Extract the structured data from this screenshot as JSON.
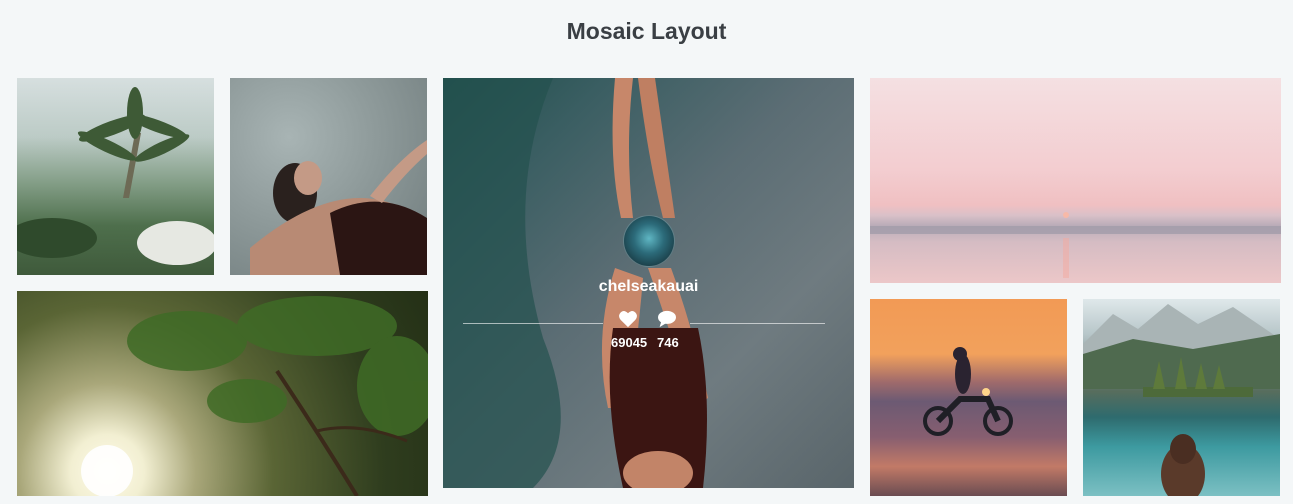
{
  "page": {
    "title": "Mosaic Layout"
  },
  "featured": {
    "username": "chelseakauai",
    "likes": "69045",
    "comments": "746"
  }
}
